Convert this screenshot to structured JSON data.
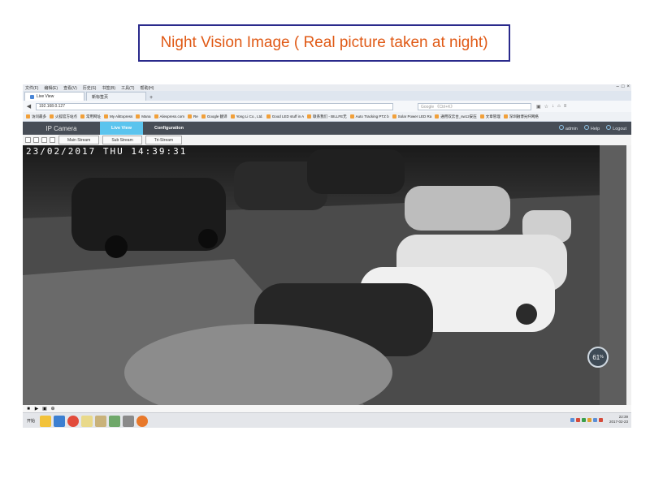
{
  "banner": {
    "title": "Night Vision Image ( Real picture taken at night)"
  },
  "browser": {
    "menu": [
      "文件(F)",
      "编辑(E)",
      "查看(V)",
      "历史(S)",
      "书签(B)",
      "工具(T)",
      "帮助(H)"
    ],
    "tabs": [
      {
        "label": "Live View",
        "active": true
      },
      {
        "label": "新标签页",
        "active": false
      }
    ],
    "new_tab": "+",
    "url": "192.168.0.127",
    "search_placeholder": "Google 《Ctrl+K》",
    "bookmarks": [
      "访问最多",
      "火狐官方站点",
      "常用网址",
      "My AliExpress",
      "Mana",
      "Aliexpress.com",
      "Re",
      "Google 翻译",
      "Yong Li Co., Ltd.",
      "Good LED stuff in A",
      "联系我们 - BILLFE无",
      "Auto Tracking PTZ b",
      "Solar Power LED Ra",
      "通用双云台_sw12安压",
      "文章管理",
      "深圳融博光纤网络"
    ]
  },
  "camera": {
    "title": "IP Camera",
    "tabs": [
      {
        "label": "Live View",
        "active": true
      },
      {
        "label": "Configuration",
        "active": false
      }
    ],
    "user": "admin",
    "help": "Help",
    "logout": "Logout",
    "streams": [
      "Main Stream",
      "Sub Stream",
      "Tri-Stream"
    ]
  },
  "video": {
    "timestamp": "23/02/2017 THU 14:39:31",
    "overlay_value": "61",
    "overlay_unit": "%"
  },
  "taskbar": {
    "start": "开始",
    "clock_time": "22:39",
    "clock_date": "2017-02-23"
  },
  "colors": {
    "banner_text": "#e05a16",
    "banner_border": "#2a2a8c",
    "camera_header": "#474d56",
    "camera_tab_active": "#5bc4ee"
  }
}
